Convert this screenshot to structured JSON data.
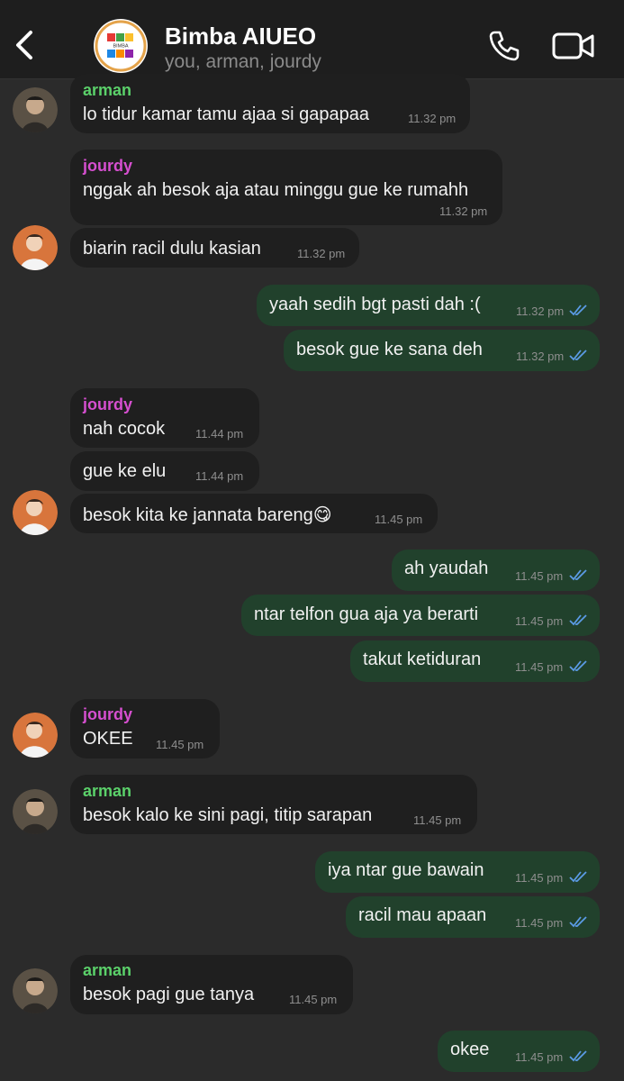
{
  "header": {
    "title": "Bimba AIUEO",
    "subtitle": "you, arman, jourdy",
    "avatar_text": "BIMBA"
  },
  "colors": {
    "background": "#2b2b2b",
    "incoming_bubble": "#1f1f1f",
    "outgoing_bubble": "#21412c",
    "arman_name": "#5bd16a",
    "jourdy_name": "#d64fd0",
    "read_ticks": "#5b9be6"
  },
  "messages": [
    {
      "sender": "arman",
      "text": "lo tidur kamar tamu ajaa si gapapaa",
      "time": "11.32 pm"
    },
    {
      "sender": "jourdy",
      "text": "nggak ah besok aja atau minggu gue ke rumahh",
      "time": "11.32 pm"
    },
    {
      "text": "biarin racil dulu kasian",
      "time": "11.32 pm"
    },
    {
      "text": "yaah sedih bgt pasti dah :(",
      "time": "11.32 pm"
    },
    {
      "text": "besok gue ke sana deh",
      "time": "11.32 pm"
    },
    {
      "sender": "jourdy",
      "text": "nah cocok",
      "time": "11.44 pm"
    },
    {
      "text": "gue ke elu",
      "time": "11.44 pm"
    },
    {
      "text": "besok kita ke jannata bareng😋",
      "time": "11.45 pm"
    },
    {
      "text": "ah yaudah",
      "time": "11.45 pm"
    },
    {
      "text": "ntar telfon gua aja ya berarti",
      "time": "11.45 pm"
    },
    {
      "text": "takut ketiduran",
      "time": "11.45 pm"
    },
    {
      "sender": "jourdy",
      "text": "OKEE",
      "time": "11.45 pm"
    },
    {
      "sender": "arman",
      "text": "besok kalo ke sini pagi, titip sarapan",
      "time": "11.45 pm"
    },
    {
      "text": "iya ntar gue bawain",
      "time": "11.45 pm"
    },
    {
      "text": "racil mau apaan",
      "time": "11.45 pm"
    },
    {
      "sender": "arman",
      "text": "besok pagi gue tanya",
      "time": "11.45 pm"
    },
    {
      "text": "okee",
      "time": "11.45 pm"
    }
  ]
}
